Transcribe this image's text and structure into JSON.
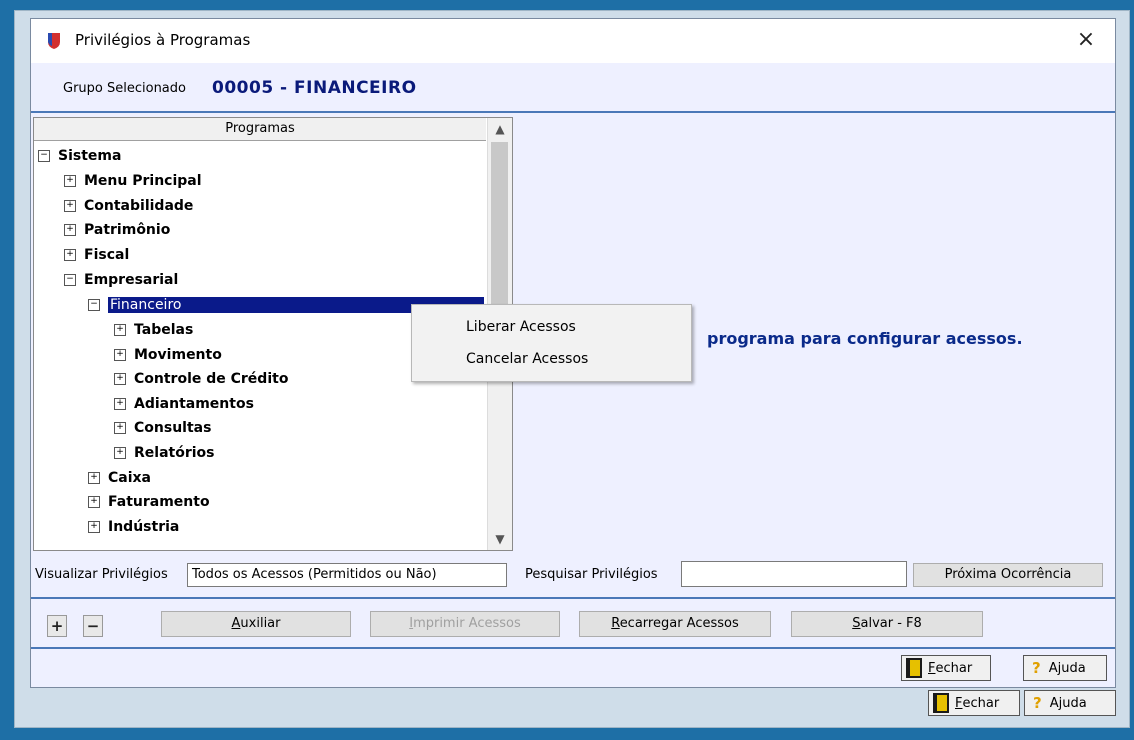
{
  "window": {
    "title": "Privilégios à Programas",
    "close_glyph": "×"
  },
  "group": {
    "label": "Grupo Selecionado",
    "value": "00005 - FINANCEIRO"
  },
  "tree": {
    "header": "Programas",
    "nodes": [
      {
        "label": "Sistema",
        "toggle": "−"
      },
      {
        "label": "Menu Principal",
        "toggle": "+"
      },
      {
        "label": "Contabilidade",
        "toggle": "+"
      },
      {
        "label": "Patrimônio",
        "toggle": "+"
      },
      {
        "label": "Fiscal",
        "toggle": "+"
      },
      {
        "label": "Empresarial",
        "toggle": "−"
      },
      {
        "label": "Financeiro",
        "toggle": "−"
      },
      {
        "label": "Tabelas",
        "toggle": "+"
      },
      {
        "label": "Movimento",
        "toggle": "+"
      },
      {
        "label": "Controle de Crédito",
        "toggle": "+"
      },
      {
        "label": "Adiantamentos",
        "toggle": "+"
      },
      {
        "label": "Consultas",
        "toggle": "+"
      },
      {
        "label": "Relatórios",
        "toggle": "+"
      },
      {
        "label": "Caixa",
        "toggle": "+"
      },
      {
        "label": "Faturamento",
        "toggle": "+"
      },
      {
        "label": "Indústria",
        "toggle": "+"
      }
    ]
  },
  "right_panel": {
    "message": "programa para configurar acessos."
  },
  "context_menu": {
    "items": [
      "Liberar Acessos",
      "Cancelar Acessos"
    ]
  },
  "filters": {
    "view_label": "Visualizar Privilégios",
    "view_value": "Todos os Acessos (Permitidos ou Não)",
    "search_label": "Pesquisar Privilégios",
    "search_value": "",
    "next_button": "Próxima Ocorrência"
  },
  "toolbar": {
    "plus": "+",
    "minus": "−",
    "auxiliar": {
      "first": "A",
      "rest": "uxiliar"
    },
    "imprimir": {
      "first": "I",
      "rest": "mprimir Acessos"
    },
    "recarregar": {
      "first": "R",
      "rest": "ecarregar Acessos"
    },
    "salvar": {
      "first": "S",
      "rest": "alvar - F8"
    }
  },
  "footer": {
    "close": {
      "first": "F",
      "rest": "echar"
    },
    "help": "Ajuda",
    "help_glyph": "?"
  }
}
